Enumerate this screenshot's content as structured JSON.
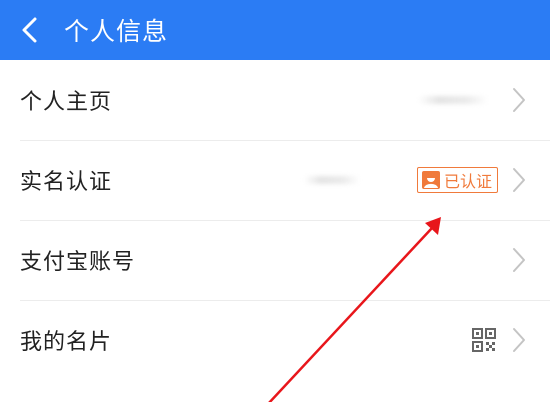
{
  "header": {
    "title": "个人信息",
    "background_color": "#2b7cf4"
  },
  "rows": [
    {
      "label": "个人主页"
    },
    {
      "label": "实名认证",
      "badge": "已认证"
    },
    {
      "label": "支付宝账号"
    },
    {
      "label": "我的名片"
    }
  ],
  "colors": {
    "badge_color": "#f07a3b",
    "arrow_color": "#e8161b"
  }
}
